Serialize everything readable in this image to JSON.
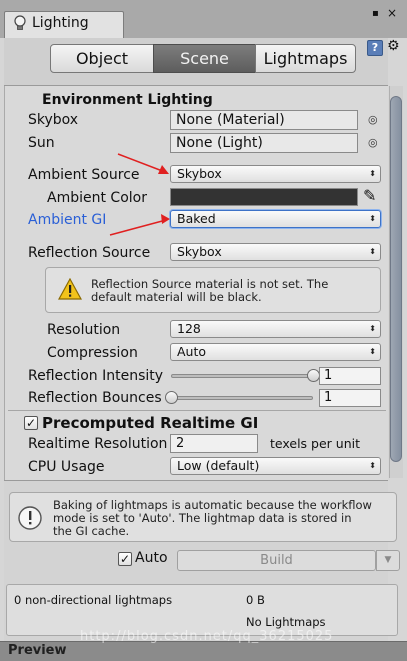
{
  "window": {
    "tab_title": "Lighting",
    "menu_glyph": "▪",
    "close_glyph": "×"
  },
  "mode_tabs": [
    {
      "label": "Object",
      "selected": false
    },
    {
      "label": "Scene",
      "selected": true
    },
    {
      "label": "Lightmaps",
      "selected": false
    }
  ],
  "environment": {
    "section_title": "Environment Lighting",
    "skybox_label": "Skybox",
    "skybox_value": "None (Material)",
    "sun_label": "Sun",
    "sun_value": "None (Light)",
    "ambient_source_label": "Ambient Source",
    "ambient_source_value": "Skybox",
    "ambient_color_label": "Ambient Color",
    "ambient_color": "#333333",
    "ambient_gi_label": "Ambient GI",
    "ambient_gi_value": "Baked",
    "reflection_source_label": "Reflection Source",
    "reflection_source_value": "Skybox",
    "warning_text_1": "Reflection Source material is not set. The",
    "warning_text_2": "default material will be black.",
    "resolution_label": "Resolution",
    "resolution_value": "128",
    "compression_label": "Compression",
    "compression_value": "Auto",
    "reflection_intensity_label": "Reflection Intensity",
    "reflection_intensity_value": "1",
    "reflection_intensity_fraction": 1.0,
    "reflection_bounces_label": "Reflection Bounces",
    "reflection_bounces_value": "1",
    "reflection_bounces_fraction": 0.0
  },
  "precomputed": {
    "section_title": "Precomputed Realtime GI",
    "enabled": true,
    "realtime_resolution_label": "Realtime Resolution",
    "realtime_resolution_value": "2",
    "realtime_resolution_unit": "texels per unit",
    "cpu_usage_label": "CPU Usage",
    "cpu_usage_value": "Low (default)"
  },
  "bake": {
    "info_line_1": "Baking of lightmaps is automatic because the workflow",
    "info_line_2": "mode is set to 'Auto'. The lightmap data is stored in",
    "info_line_3": "the GI cache.",
    "auto_label": "Auto",
    "auto_checked": true,
    "build_label": "Build"
  },
  "stats": {
    "lightmap_count": "0 non-directional lightmaps",
    "size": "0 B",
    "status": "No Lightmaps"
  },
  "footer": {
    "preview_label": "Preview",
    "watermark": "http://blog.csdn.net/qq_36215025"
  },
  "colors": {
    "annotation_arrow": "#e02020",
    "ambient_gi_label": "#2a5fd6",
    "selected_tab": "#6b6b6b"
  }
}
